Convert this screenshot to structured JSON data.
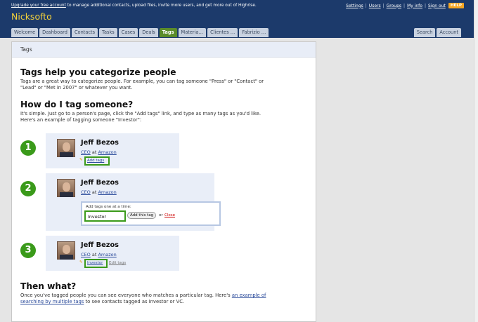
{
  "topbar": {
    "upgrade_link": "Upgrade your free account",
    "upgrade_text": " to manage additional contacts, upload files, invite more users, and get more out of Highrise.",
    "brand": "Nicksofto",
    "links": {
      "settings": "Settings",
      "users": "Users",
      "groups": "Groups",
      "myinfo": "My info",
      "signout": "Sign out",
      "help": "HELP"
    }
  },
  "tabs": [
    "Welcome",
    "Dashboard",
    "Contacts",
    "Tasks",
    "Cases",
    "Deals",
    "Tags",
    "Materia…",
    "Clientes …",
    "Fabrizio …"
  ],
  "right_tabs": [
    "Search",
    "Account"
  ],
  "panel": {
    "header": "Tags",
    "h1": "Tags help you categorize people",
    "intro1": "Tags are a great way to categorize people. For example, you can tag someone \"Press\" or \"Contact\" or",
    "intro2": "\"Lead\" or \"Met in 2007\" or whatever you want.",
    "h2": "How do I tag someone?",
    "how1": "It's simple. Just go to a person's page, click the \"Add tags\" link, and type as many tags as you'd like.",
    "how2": "Here's an example of tagging someone \"Investor\":",
    "person": {
      "name": "Jeff Bezos",
      "title": "CEO",
      "at": "at",
      "company": "Amazon"
    },
    "steps": [
      "1",
      "2",
      "3"
    ],
    "add_tags_link": "Add tags",
    "add_prompt": "Add tags one at a time:",
    "input_value": "Investor",
    "add_button": "Add this tag",
    "or": "or",
    "close": "Close",
    "tag_investor": "Investor",
    "edit_tags": "Edit tags",
    "h3": "Then what?",
    "then1": "Once you've tagged people you can see everyone who matches a particular tag. Here's",
    "then_link1": "an example of",
    "then_link2": "searching by multiple tags",
    "then2": " to see contacts tagged as Investor or VC."
  }
}
